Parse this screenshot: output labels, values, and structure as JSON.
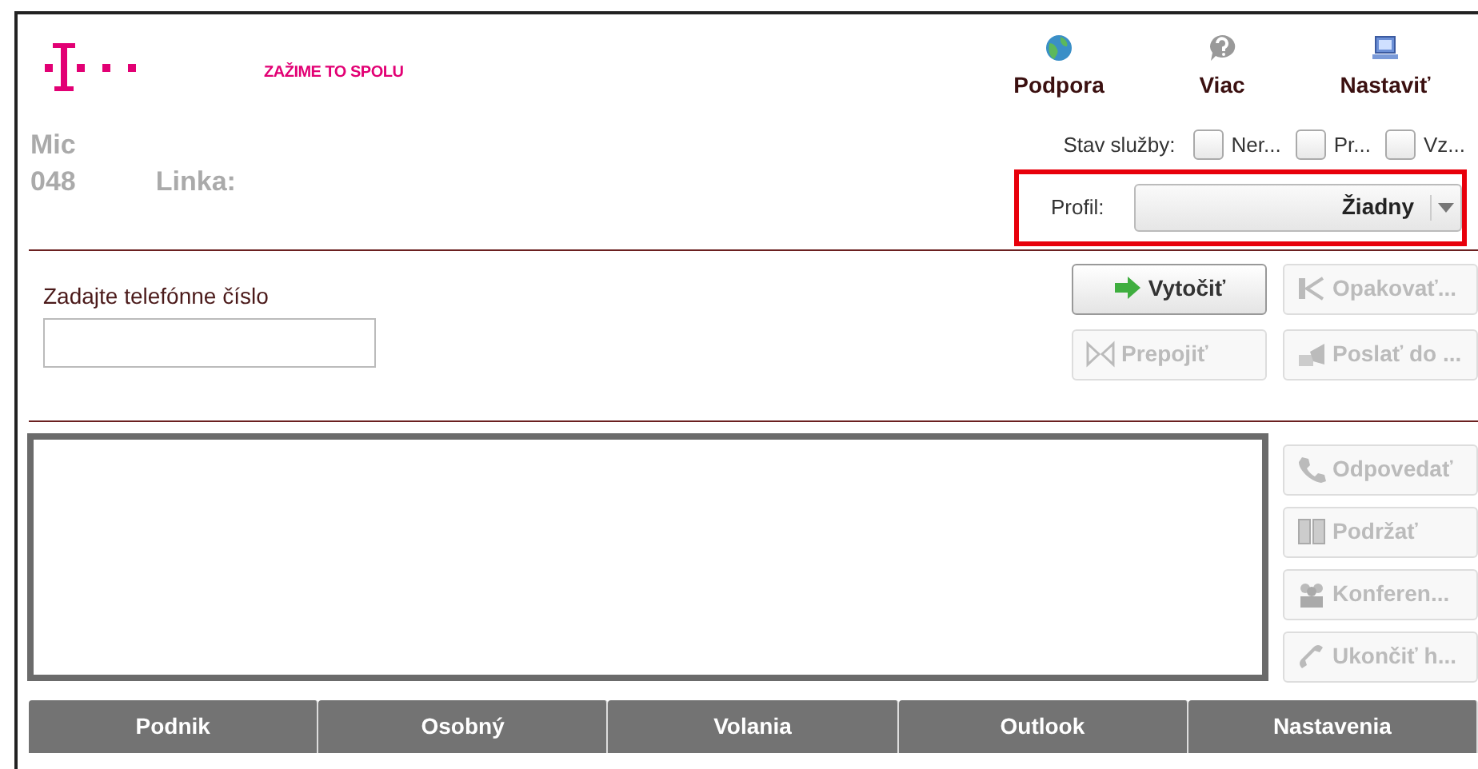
{
  "header": {
    "tagline": "ZAŽIME TO SPOLU",
    "nav": [
      {
        "label": "Podpora",
        "kind": "globe"
      },
      {
        "label": "Viac",
        "kind": "help"
      },
      {
        "label": "Nastaviť",
        "kind": "computer"
      }
    ]
  },
  "user": {
    "name": "Mic",
    "number": "048",
    "line_label": "Linka:"
  },
  "service_status": {
    "label": "Stav služby:",
    "options": [
      {
        "label": "Ner...",
        "checked": false
      },
      {
        "label": "Pr...",
        "checked": false
      },
      {
        "label": "Vz...",
        "checked": false
      }
    ]
  },
  "profile": {
    "label": "Profil:",
    "value": "Žiadny"
  },
  "dial": {
    "label": "Zadajte telefónne číslo"
  },
  "call_buttons": [
    {
      "label": "Vytočiť",
      "kind": "dial",
      "disabled": false
    },
    {
      "label": "Opakovať...",
      "kind": "redial",
      "disabled": true
    },
    {
      "label": "Prepojiť",
      "kind": "transfer",
      "disabled": true
    },
    {
      "label": "Poslať do ...",
      "kind": "send",
      "disabled": true
    }
  ],
  "session_buttons": [
    {
      "label": "Odpovedať",
      "kind": "answer",
      "disabled": true
    },
    {
      "label": "Podržať",
      "kind": "hold",
      "disabled": true
    },
    {
      "label": "Konferen...",
      "kind": "conference",
      "disabled": true
    },
    {
      "label": "Ukončiť h...",
      "kind": "hangup",
      "disabled": true
    }
  ],
  "tabs": [
    {
      "label": "Podnik"
    },
    {
      "label": "Osobný"
    },
    {
      "label": "Volania"
    },
    {
      "label": "Outlook"
    },
    {
      "label": "Nastavenia"
    }
  ]
}
